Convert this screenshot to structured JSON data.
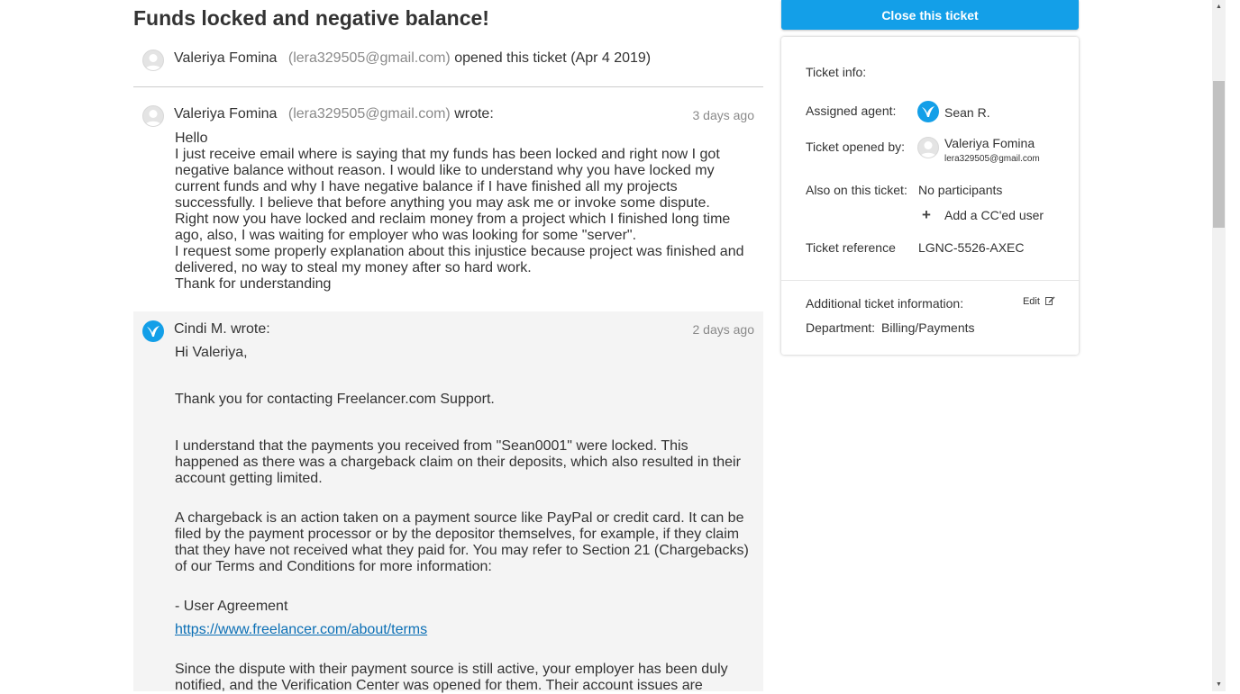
{
  "ticket": {
    "title": "Funds locked and negative balance!",
    "opener_name": "Valeriya Fomina",
    "opener_email": "(lera329505@gmail.com)",
    "opened_text": "opened this ticket",
    "opened_date": "(Apr 4 2019)"
  },
  "messages": [
    {
      "author": "Valeriya Fomina",
      "email": "(lera329505@gmail.com)",
      "verb": "wrote:",
      "time": "3 days ago",
      "lines": [
        "Hello",
        "I just receive email where is saying that my funds has been locked and right now I got negative balance without reason. I would like to understand why you have locked my current funds and why I have negative balance if I have finished all my projects successfully. I believe that before anything you may ask me or invoke some dispute.",
        "Right now you have locked and reclaim money from a project which I finished long time ago, also, I was waiting for employer who was looking for some \"server\".",
        "I request some properly explanation about this injustice because project was finished and delivered, no way to steal my money after so hard work.",
        "Thank for understanding"
      ]
    },
    {
      "author": "Cindi M. wrote:",
      "time": "2 days ago",
      "greeting": "Hi Valeriya,",
      "para_thanks": "Thank you for contacting Freelancer.com Support.",
      "para_locked": "I understand that the payments you received from \"Sean0001\" were locked. This happened as there was a chargeback claim on their deposits, which also resulted in their account getting limited.",
      "para_chargeback": "A chargeback is an action taken on a payment source like PayPal or credit card. It can be filed by the payment processor or by the depositor themselves, for example, if they claim that they have not received what they paid for. You may refer to Section 21 (Chargebacks) of our Terms and Conditions for more information:",
      "agreement_label": "- User Agreement",
      "agreement_link": "https://www.freelancer.com/about/terms",
      "para_dispute": "Since the dispute with their payment source is still active, your employer has been duly notified, and the Verification Center was opened for them. Their account issues are"
    }
  ],
  "sidebar": {
    "close_button": "Close this ticket",
    "ticket_info_label": "Ticket info:",
    "assigned_agent_label": "Assigned agent:",
    "assigned_agent_name": "Sean R.",
    "opened_by_label": "Ticket opened by:",
    "opened_by_name": "Valeriya Fomina",
    "opened_by_email": "lera329505@gmail.com",
    "also_on_label": "Also on this ticket:",
    "also_on_value": "No participants",
    "add_cc_label": "Add a CC'ed user",
    "reference_label": "Ticket reference",
    "reference_value": "LGNC-5526-AXEC",
    "additional_info_label": "Additional ticket information:",
    "edit_label": "Edit",
    "department_label": "Department:",
    "department_value": "Billing/Payments"
  },
  "colors": {
    "accent": "#139fe8",
    "link": "#0b6fb5",
    "reply_background": "#f4f4f4",
    "muted_text": "#8a8a8a"
  },
  "icons": [
    "user-avatar-icon",
    "agent-bird-icon",
    "plus-icon",
    "edit-pencil-icon",
    "scroll-up-arrow-icon",
    "scroll-down-arrow-icon"
  ]
}
